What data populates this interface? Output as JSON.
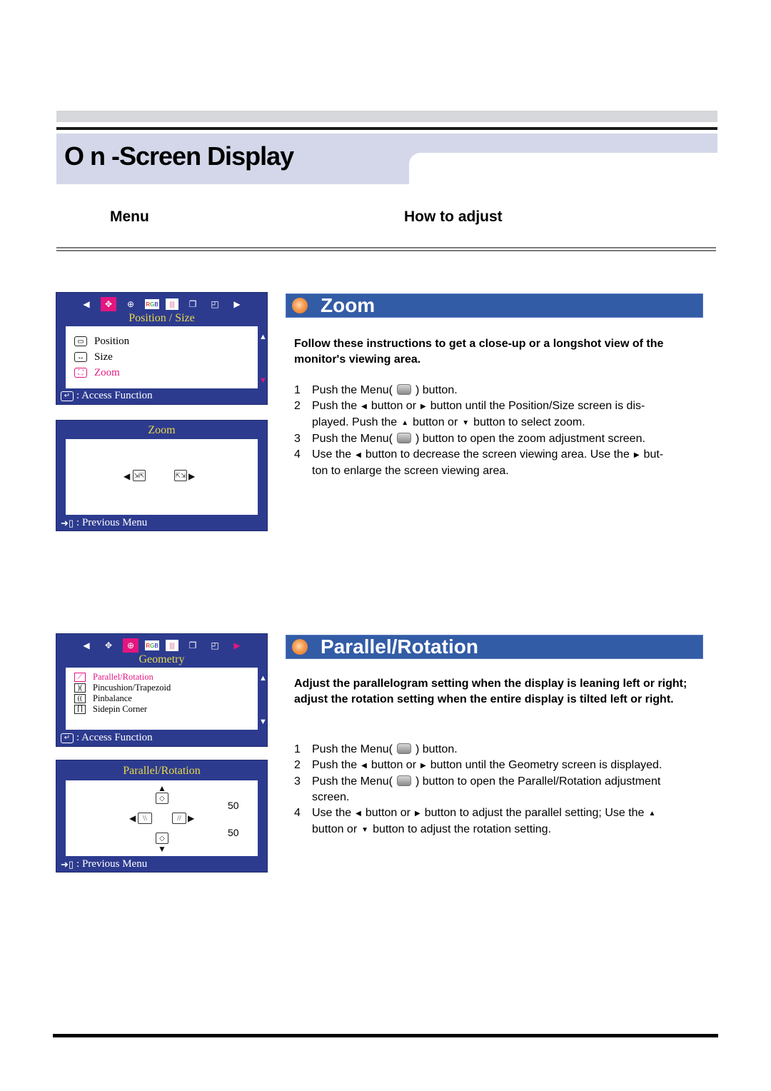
{
  "header": {
    "title": "O n -Screen Display",
    "col_menu": "Menu",
    "col_adjust": "How to adjust"
  },
  "osd_position_size": {
    "tabs": [
      {
        "icon": "position-size-icon",
        "selected": true
      },
      {
        "icon": "geometry-icon",
        "selected": false
      },
      {
        "icon": "rgb-icon",
        "label": "RGB",
        "selected": false
      },
      {
        "icon": "color-bars-icon",
        "selected": false
      },
      {
        "icon": "multi-window-icon",
        "selected": false
      },
      {
        "icon": "window-layout-icon",
        "selected": false
      }
    ],
    "caption": "Position / Size",
    "items": [
      "Position",
      "Size",
      "Zoom"
    ],
    "selected_item": "Zoom",
    "footer": ": Access Function"
  },
  "osd_zoom": {
    "caption": "Zoom",
    "footer": ": Previous Menu"
  },
  "osd_geometry": {
    "caption": "Geometry",
    "items": [
      "Parallel/Rotation",
      "Pincushion/Trapezoid",
      "Pinbalance",
      "Sidepin Corner"
    ],
    "selected_item": "Parallel/Rotation",
    "footer": ": Access Function"
  },
  "osd_parallel": {
    "caption": "Parallel/Rotation",
    "parallel_value": "50",
    "rotation_value": "50",
    "footer": ": Previous Menu"
  },
  "zoom_section": {
    "title": "Zoom",
    "intro": "Follow these instructions to get a close-up or a longshot view of the monitor's viewing area.",
    "steps": [
      {
        "n": "1",
        "parts": [
          "Push the Menu(",
          ") button."
        ]
      },
      {
        "n": "2",
        "parts": [
          "Push the",
          "button or",
          "button until the Position/Size screen is dis-",
          "played. Push the",
          "button or",
          "button to select zoom."
        ]
      },
      {
        "n": "3",
        "parts": [
          "Push the Menu(",
          ") button to open the zoom adjustment screen."
        ]
      },
      {
        "n": "4",
        "parts": [
          "Use the",
          "button to decrease the screen viewing area. Use the",
          "but-",
          "ton to enlarge the screen viewing area."
        ]
      }
    ]
  },
  "parallel_section": {
    "title": "Parallel/Rotation",
    "intro": "Adjust the parallelogram setting when the display is leaning left or right; adjust the rotation setting when the entire display is tilted left or right.",
    "steps": [
      {
        "n": "1",
        "parts": [
          "Push the Menu(",
          ") button."
        ]
      },
      {
        "n": "2",
        "parts": [
          "Push the",
          "button or",
          "button until the Geometry screen is displayed."
        ]
      },
      {
        "n": "3",
        "parts": [
          "Push the Menu(",
          ") button to open the Parallel/Rotation adjustment",
          "screen."
        ]
      },
      {
        "n": "4",
        "parts": [
          "Use the",
          "button or",
          "button to adjust the parallel setting; Use the",
          "button or",
          "button to adjust the rotation setting."
        ]
      }
    ]
  },
  "colors": {
    "osd_blue": "#2d3b8f",
    "osd_highlight": "#e5157f",
    "osd_caption": "#e8d84a",
    "section_header": "#335ca6",
    "title_band": "#d3d7e9"
  }
}
